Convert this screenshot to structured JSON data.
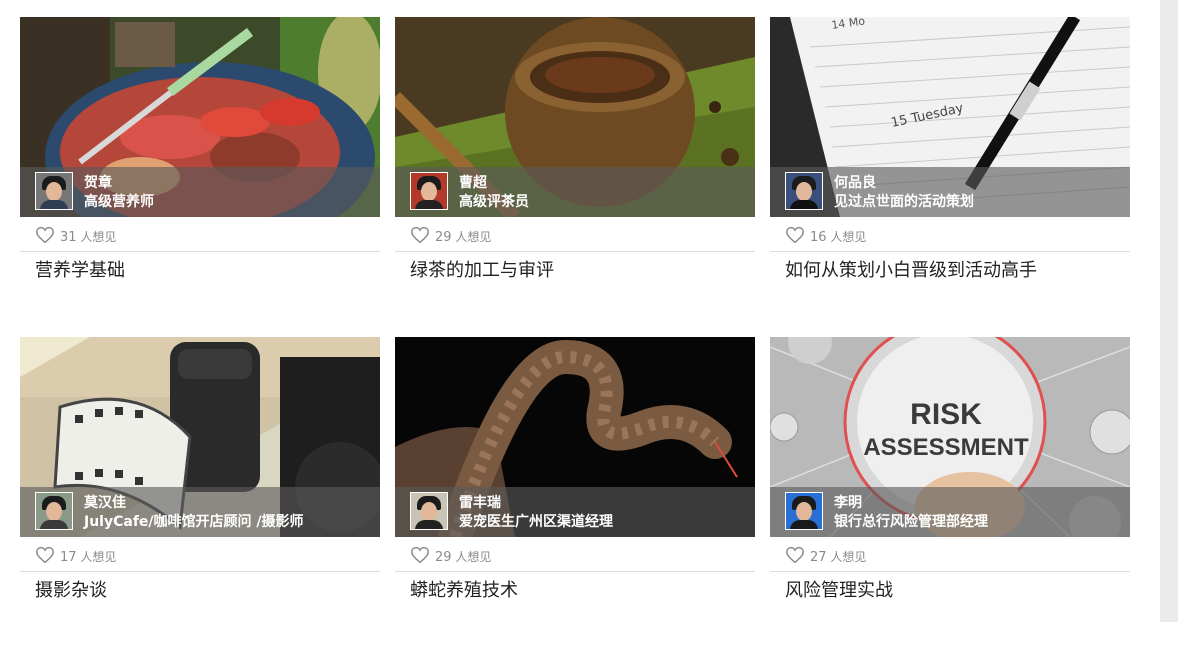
{
  "like_suffix": "人想见",
  "colors": {
    "overlay": "#5a5a5a",
    "divider": "#dcdcdc",
    "title": "#222222",
    "meta": "#8a8a8a"
  },
  "cards": [
    {
      "teacher": "贺章",
      "teacher_title": "高级营养师",
      "likes": "31",
      "course": "营养学基础",
      "icon": "heart-icon"
    },
    {
      "teacher": "曹超",
      "teacher_title": "高级评茶员",
      "likes": "29",
      "course": "绿茶的加工与审评",
      "icon": "heart-icon"
    },
    {
      "teacher": "何品良",
      "teacher_title": "见过点世面的活动策划",
      "likes": "16",
      "course": "如何从策划小白晋级到活动高手",
      "icon": "heart-icon"
    },
    {
      "teacher": "莫汉佳",
      "teacher_title": "JulyCafe/咖啡馆开店顾问 /摄影师",
      "likes": "17",
      "course": "摄影杂谈",
      "icon": "heart-icon"
    },
    {
      "teacher": "雷丰瑞",
      "teacher_title": "爱宠医生广州区渠道经理",
      "likes": "29",
      "course": "蟒蛇养殖技术",
      "icon": "heart-icon"
    },
    {
      "teacher": "李明",
      "teacher_title": "银行总行风险管理部经理",
      "likes": "27",
      "course": "风险管理实战",
      "icon": "heart-icon"
    }
  ],
  "image_text": {
    "risk_line1": "RISK",
    "risk_line2": "ASSESSMENT",
    "planner_day": "15 Tuesday",
    "planner_top": "14 Mo"
  }
}
